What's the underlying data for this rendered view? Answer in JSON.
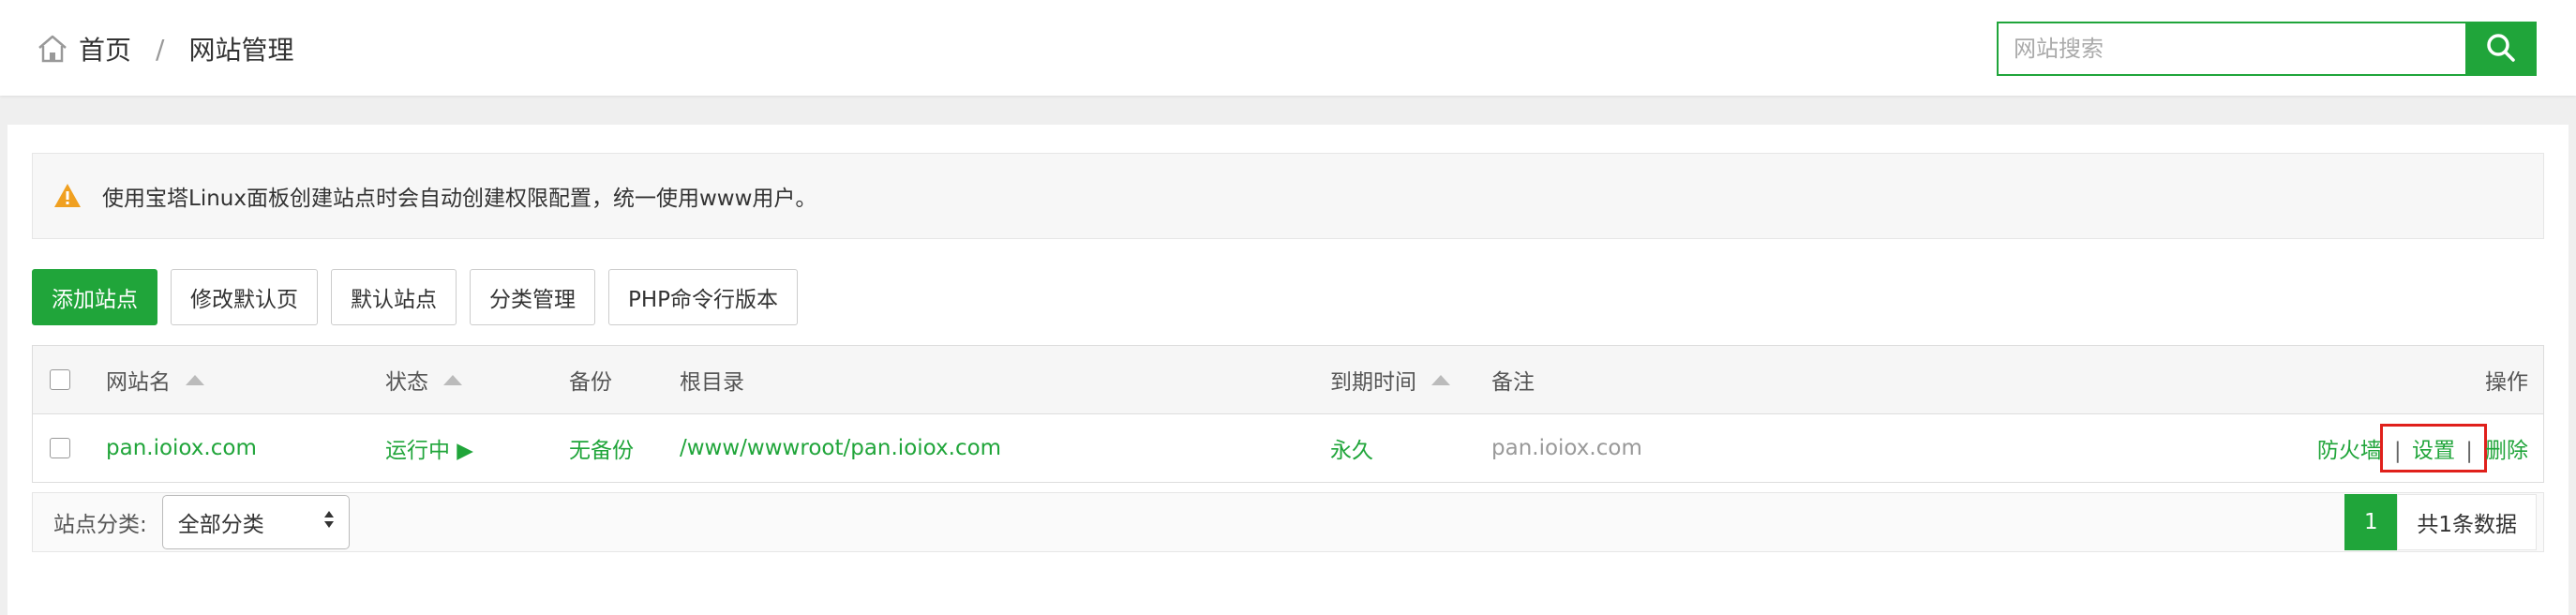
{
  "breadcrumb": {
    "home": "首页",
    "separator": "/",
    "current": "网站管理"
  },
  "search": {
    "placeholder": "网站搜索",
    "value": ""
  },
  "alert": {
    "text": "使用宝塔Linux面板创建站点时会自动创建权限配置，统一使用www用户。"
  },
  "toolbar": {
    "add_site": "添加站点",
    "edit_default_page": "修改默认页",
    "default_site": "默认站点",
    "category_manage": "分类管理",
    "php_cli_version": "PHP命令行版本"
  },
  "table": {
    "headers": {
      "name": "网站名",
      "status": "状态",
      "backup": "备份",
      "root": "根目录",
      "expire": "到期时间",
      "remark": "备注",
      "actions": "操作"
    },
    "rows": [
      {
        "name": "pan.ioiox.com",
        "status": "运行中 ▶",
        "backup": "无备份",
        "root": "/www/wwwroot/pan.ioiox.com",
        "expire": "永久",
        "remark": "pan.ioiox.com",
        "actions": {
          "firewall": "防火墙",
          "settings": "设置",
          "delete": "删除",
          "pipe": "|"
        }
      }
    ]
  },
  "footer": {
    "category_label": "站点分类:",
    "category_selected": "全部分类",
    "current_page": "1",
    "total": "共1条数据"
  },
  "colors": {
    "accent": "#20a53a",
    "highlight": "#e0201b",
    "warning": "#f0a020"
  },
  "icons": [
    "home-icon",
    "search-icon",
    "warning-icon",
    "sort-asc-icon",
    "select-updown-icon"
  ]
}
